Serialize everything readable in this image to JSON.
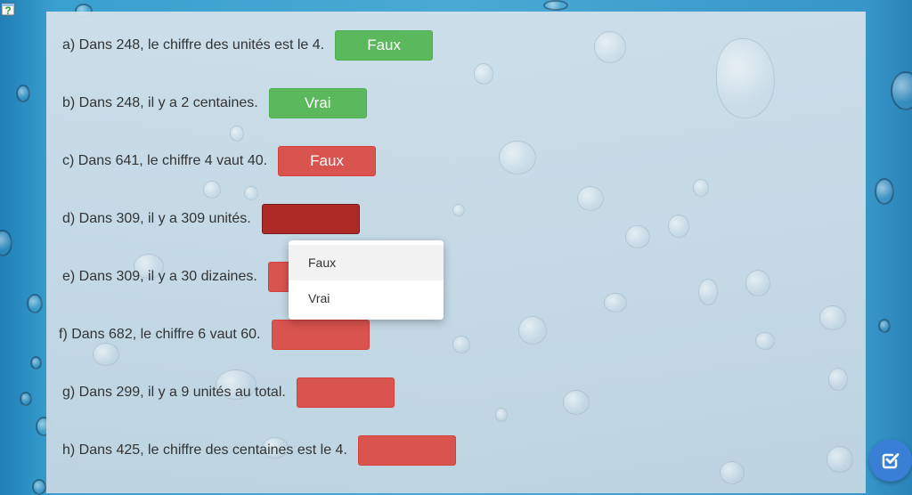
{
  "app": {
    "help_icon": "help-question-icon",
    "check_button_icon": "check-square-icon"
  },
  "questions": [
    {
      "text": "a) Dans 248, le chiffre des unités est le 4.",
      "answer": "Faux",
      "state": "correct"
    },
    {
      "text": "b) Dans 248, il y a 2 centaines.",
      "answer": "Vrai",
      "state": "correct"
    },
    {
      "text": "c) Dans 641, le chiffre 4 vaut 40.",
      "answer": "Faux",
      "state": "incorrect"
    },
    {
      "text": "d) Dans 309, il y a 309 unités.",
      "answer": "",
      "state": "open"
    },
    {
      "text": "e) Dans 309, il y a 30 dizaines.",
      "answer": "",
      "state": "empty"
    },
    {
      "text": "f) Dans 682, le chiffre 6 vaut 60.",
      "answer": "",
      "state": "empty"
    },
    {
      "text": "g) Dans 299, il y a 9 unités au total.",
      "answer": "",
      "state": "empty"
    },
    {
      "text": "h) Dans 425, le chiffre des centaines est le 4.",
      "answer": "",
      "state": "empty"
    }
  ],
  "dropdown": {
    "options": [
      "Faux",
      "Vrai"
    ]
  },
  "colors": {
    "correct": "#5cb85c",
    "incorrect": "#d9534f",
    "open": "#ac2925",
    "accent": "#3a7fd6"
  }
}
